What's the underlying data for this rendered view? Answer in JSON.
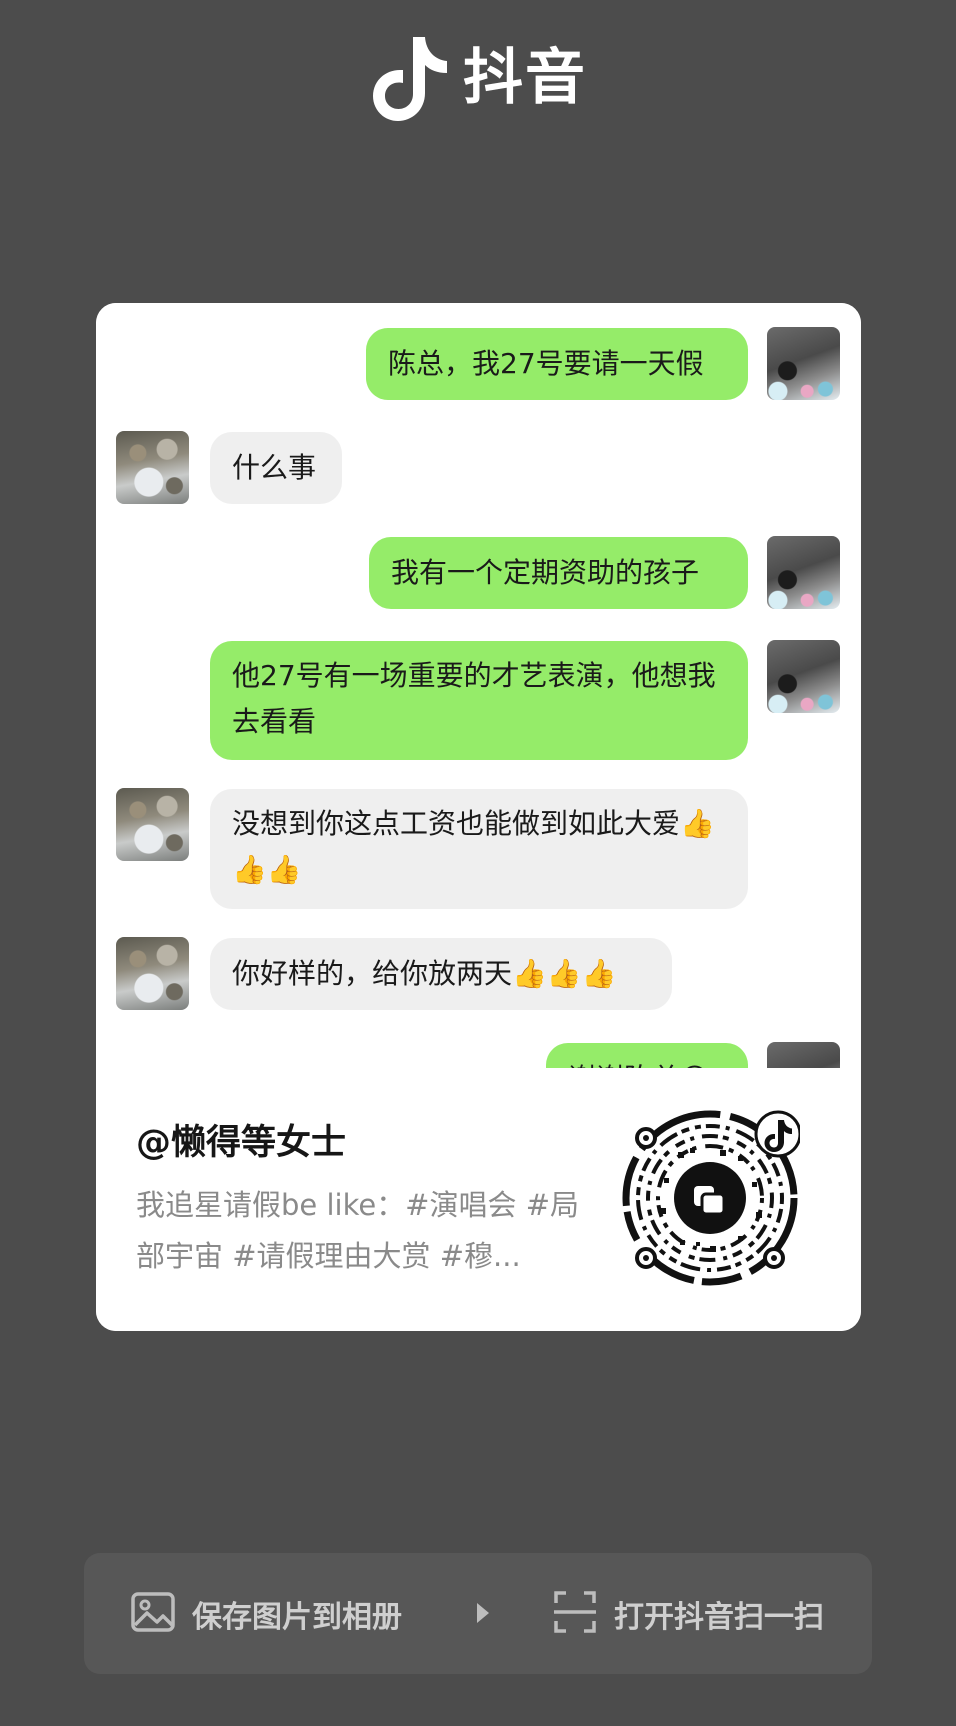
{
  "brand": {
    "name": "抖音"
  },
  "chat": {
    "messages": [
      {
        "side": "right",
        "text": "陈总，我27号要请一天假"
      },
      {
        "side": "left",
        "text": "什么事"
      },
      {
        "side": "right",
        "text": "我有一个定期资助的孩子"
      },
      {
        "side": "right",
        "text": "他27号有一场重要的才艺表演，他想我去看看"
      },
      {
        "side": "left",
        "text": "没想到你这点工资也能做到如此大爱👍👍👍"
      },
      {
        "side": "left",
        "text": "你好样的，给你放两天👍👍👍"
      },
      {
        "side": "right",
        "text": "谢谢陈总😊"
      }
    ]
  },
  "card": {
    "author": "@懒得等女士",
    "description": "我追星请假be like：#演唱会 #局部宇宙 #请假理由大赏 #穆..."
  },
  "actions": {
    "save_label": "保存图片到相册",
    "scan_label": "打开抖音扫一扫"
  },
  "colors": {
    "background": "#4c4c4c",
    "bubble_green": "#95ec69",
    "bubble_gray": "#efefef"
  }
}
